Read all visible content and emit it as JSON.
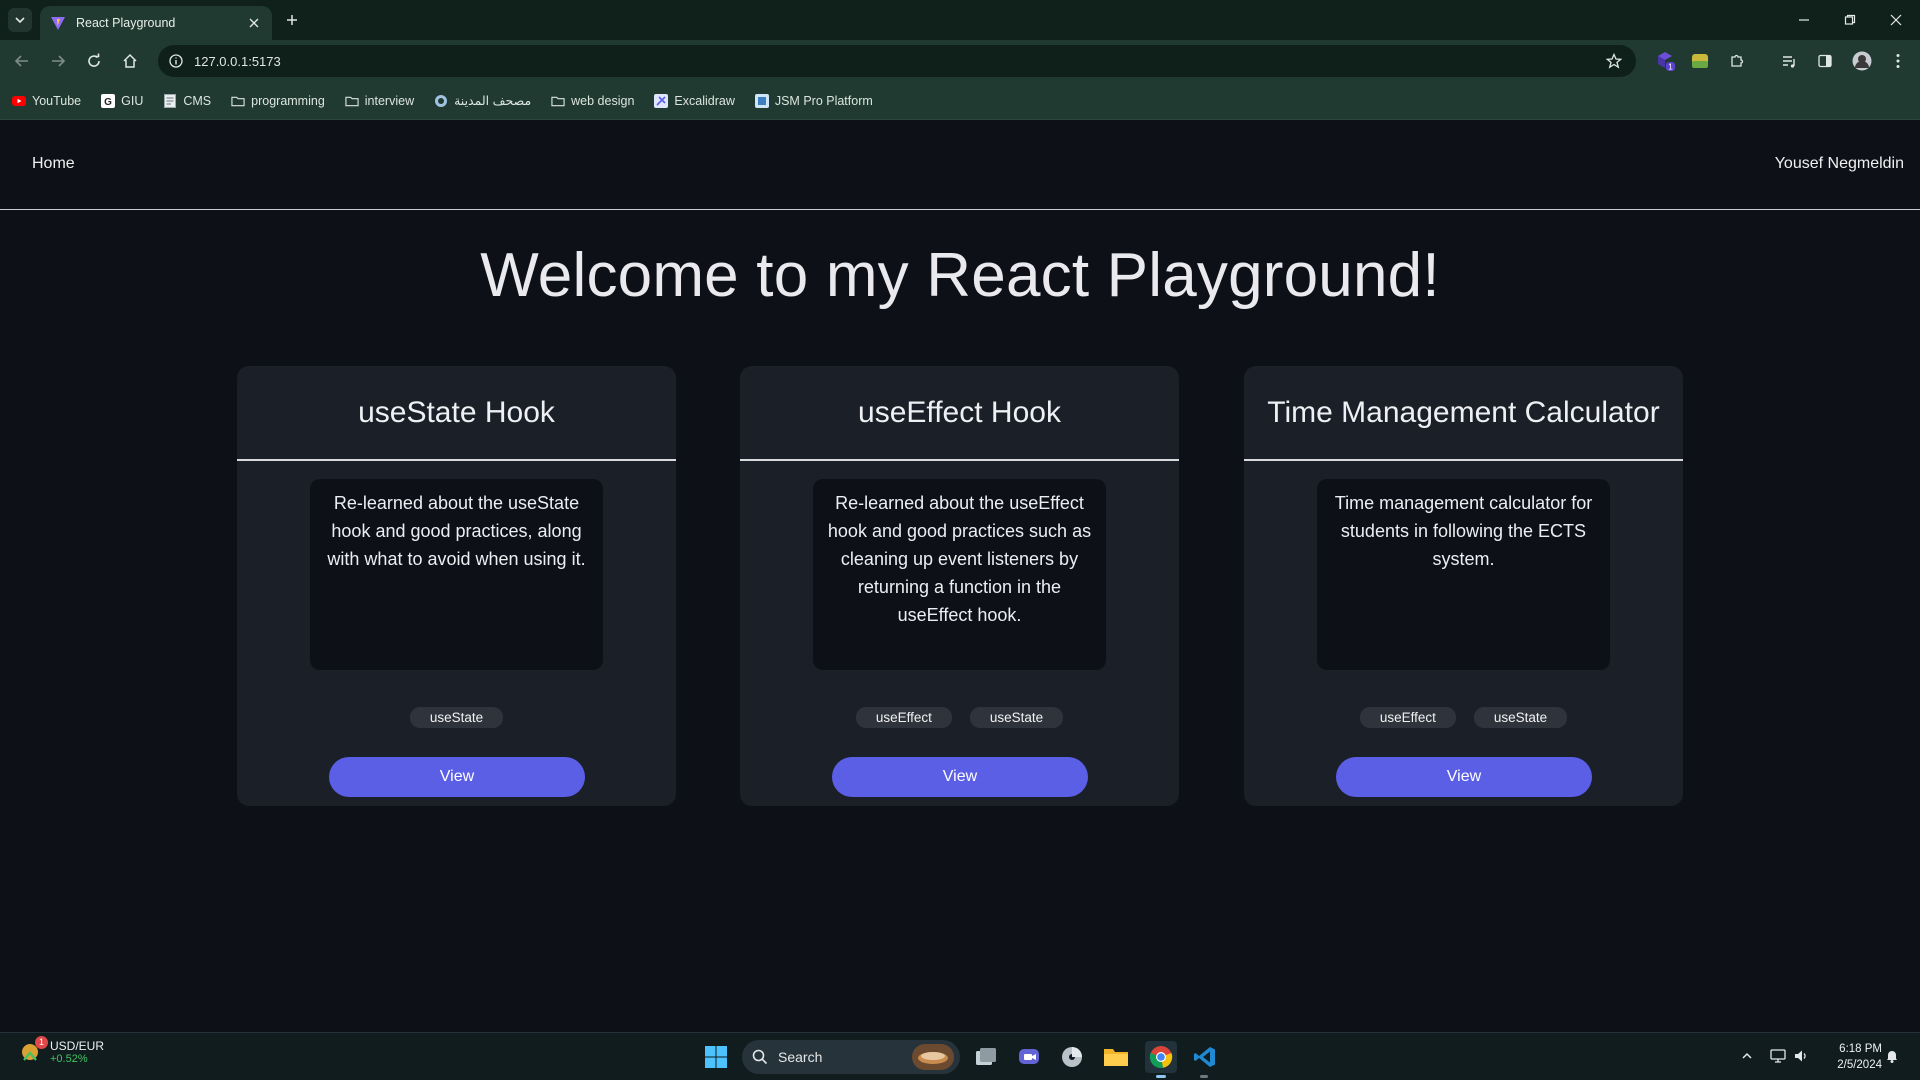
{
  "browser": {
    "tab_title": "React Playground",
    "url": "127.0.0.1:5173",
    "bookmarks": [
      {
        "label": "YouTube",
        "icon": "youtube-icon"
      },
      {
        "label": "GIU",
        "icon": "g-logo-icon"
      },
      {
        "label": "CMS",
        "icon": "document-icon"
      },
      {
        "label": "programming",
        "icon": "folder-icon"
      },
      {
        "label": "interview",
        "icon": "folder-icon"
      },
      {
        "label": "مصحف المدينة",
        "icon": "globe-icon"
      },
      {
        "label": "web design",
        "icon": "folder-icon"
      },
      {
        "label": "Excalidraw",
        "icon": "excalidraw-icon"
      },
      {
        "label": "JSM Pro Platform",
        "icon": "jsm-icon"
      }
    ],
    "extension_badge": "1"
  },
  "nav": {
    "home": "Home",
    "user": "Yousef Negmeldin"
  },
  "heading": "Welcome to my React Playground!",
  "cards": [
    {
      "title": "useState Hook",
      "description": "Re-learned about the useState hook and good practices, along with what to avoid when using it.",
      "tags": [
        "useState"
      ],
      "button": "View"
    },
    {
      "title": "useEffect Hook",
      "description": "Re-learned about the useEffect hook and good practices such as cleaning up event listeners by returning a function in the useEffect hook.",
      "tags": [
        "useEffect",
        "useState"
      ],
      "button": "View"
    },
    {
      "title": "Time Management Calculator",
      "description": "Time management calculator for students in following the ECTS system.",
      "tags": [
        "useEffect",
        "useState"
      ],
      "button": "View"
    }
  ],
  "taskbar": {
    "widget_title": "USD/EUR",
    "widget_change": "+0.52%",
    "widget_badge": "1",
    "search_label": "Search",
    "time": "6:18 PM",
    "date": "2/5/2024"
  },
  "colors": {
    "accent": "#5b5fe6",
    "page_bg": "#0d1117",
    "card_bg": "#1b1f27",
    "chrome_bg": "#203a31"
  }
}
